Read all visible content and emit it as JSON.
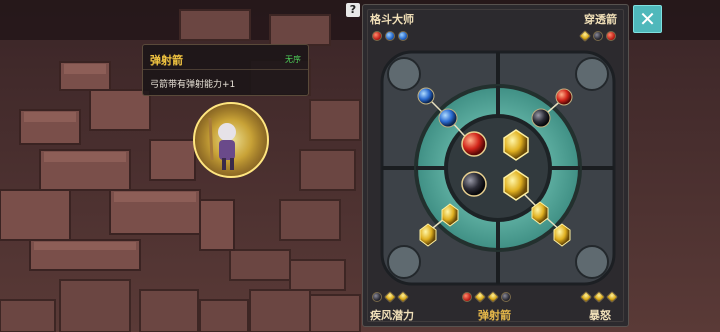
{
  "help": {
    "icon": "question-icon",
    "label": "?"
  },
  "tooltip": {
    "title": "弹射箭",
    "tag": "无序",
    "description": "弓箭带有弹射能力+1"
  },
  "panel": {
    "top_left_title": "格斗大师",
    "top_right_title": "穿透箭",
    "bottom_left_title": "疾风潜力",
    "bottom_center_title": "弹射箭",
    "bottom_right_title": "暴怒",
    "top_left_gems": [
      "red",
      "blue",
      "blue"
    ],
    "top_right_gems": [
      "gold",
      "dark",
      "red"
    ],
    "bottom_left_gems": [
      "dark",
      "gold",
      "gold"
    ],
    "bottom_center_gems": [
      "red",
      "gold",
      "gold",
      "dark"
    ],
    "bottom_right_gems": [
      "gold",
      "gold",
      "gold"
    ]
  },
  "close_button": {
    "icon": "close-icon",
    "label": "✕"
  },
  "colors": {
    "accent_teal": "#4fb8bb",
    "title_gold": "#f2c541",
    "tag_green": "#4fd35a",
    "board_teal": "#5fb6a8"
  }
}
